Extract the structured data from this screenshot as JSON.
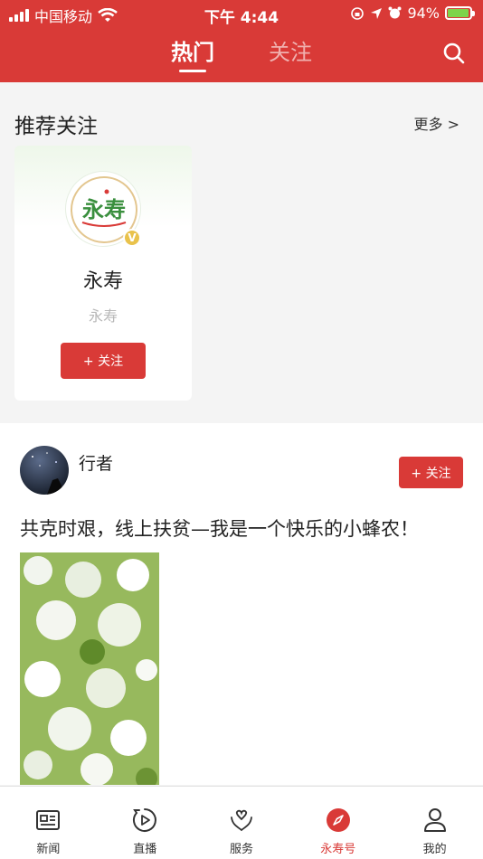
{
  "status_bar": {
    "carrier": "中国移动",
    "time": "下午 4:44",
    "battery": "94%",
    "battery_level": 0.94
  },
  "header": {
    "tabs": [
      {
        "label": "热门",
        "active": true
      },
      {
        "label": "关注",
        "active": false
      }
    ],
    "search_icon": "search-icon"
  },
  "recommend": {
    "title": "推荐关注",
    "more": "更多 >",
    "cards": [
      {
        "name": "永寿",
        "subtitle": "永寿",
        "badge": "V",
        "follow": "+ 关注"
      }
    ]
  },
  "post": {
    "author": "行者",
    "follow": "+ 关注",
    "title": "共克时艰，线上扶贫—我是一个快乐的小蜂农！"
  },
  "bottom_nav": [
    {
      "label": "新闻",
      "icon": "news-icon",
      "active": false
    },
    {
      "label": "直播",
      "icon": "play-icon",
      "active": false
    },
    {
      "label": "服务",
      "icon": "service-icon",
      "active": false
    },
    {
      "label": "永寿号",
      "icon": "compass-icon",
      "active": true
    },
    {
      "label": "我的",
      "icon": "user-icon",
      "active": false
    }
  ],
  "colors": {
    "brand": "#d93a37",
    "badge": "#e9c24b",
    "battery_fill": "#7dd44a"
  }
}
